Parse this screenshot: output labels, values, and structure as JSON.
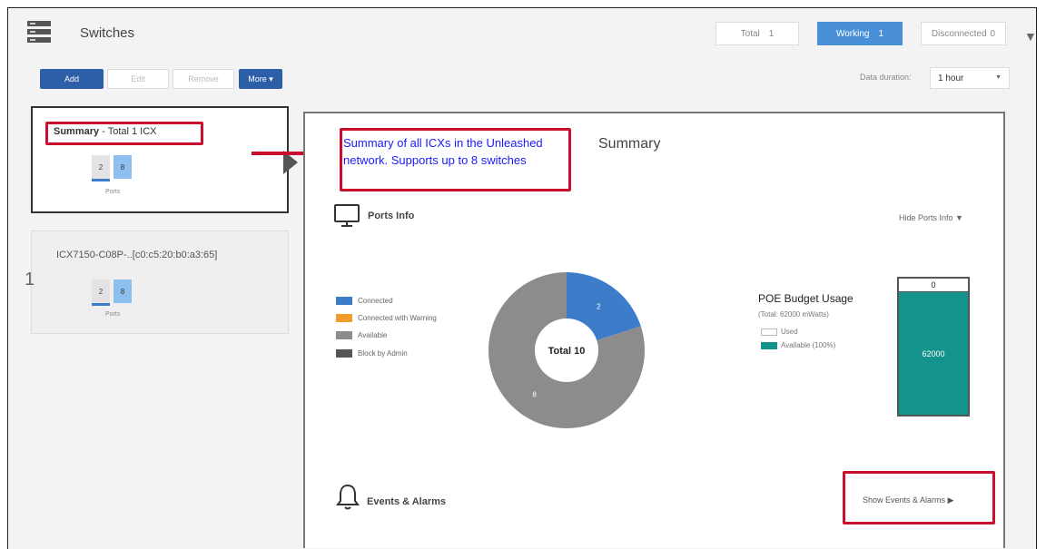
{
  "header": {
    "title": "Switches",
    "icon": "switch-stack-icon"
  },
  "stats": {
    "total_label": "Total",
    "total_value": "1",
    "working_label": "Working",
    "working_value": "1",
    "disconnected_label": "Disconnected",
    "disconnected_value": "0"
  },
  "toolbar": {
    "add": "Add",
    "edit": "Edit",
    "remove": "Remove",
    "more": "More ▾"
  },
  "duration": {
    "label": "Data duration:",
    "value": "1 hour"
  },
  "sidebar": {
    "summary_bold": "Summary",
    "summary_rest": " - Total 1 ICX",
    "mini_a": "2",
    "mini_b": "8",
    "ports_label": "Ports",
    "row_number": "1",
    "icx_name": "ICX7150-C08P-..[c0:c5:20:b0:a3:65]"
  },
  "callout": {
    "text": "Summary of all ICXs in the Unleashed network. Supports up to 8 switches"
  },
  "main": {
    "title": "Summary",
    "ports_info": "Ports Info",
    "hide_ports_info": "Hide Ports Info",
    "events_alarms": "Events & Alarms",
    "show_events": "Show Events & Alarms"
  },
  "legend": [
    {
      "label": "Connected",
      "color": "#3d7cc9"
    },
    {
      "label": "Connected with Warning",
      "color": "#f39c2c"
    },
    {
      "label": "Available",
      "color": "#8c8c8c"
    },
    {
      "label": "Block by Admin",
      "color": "#555555"
    }
  ],
  "poe": {
    "title": "POE Budget Usage",
    "total": "(Total: 62000 mWatts)",
    "used_label": "Used",
    "available_label": "Available (100%)",
    "used_value": "0",
    "available_value": "62000",
    "available_color": "#13938b"
  },
  "chart_data": {
    "type": "pie",
    "center_label": "Total 10",
    "slices": [
      {
        "label": "Connected",
        "value": 2,
        "color": "#3d7cc9"
      },
      {
        "label": "Available",
        "value": 8,
        "color": "#8c8c8c"
      }
    ]
  }
}
